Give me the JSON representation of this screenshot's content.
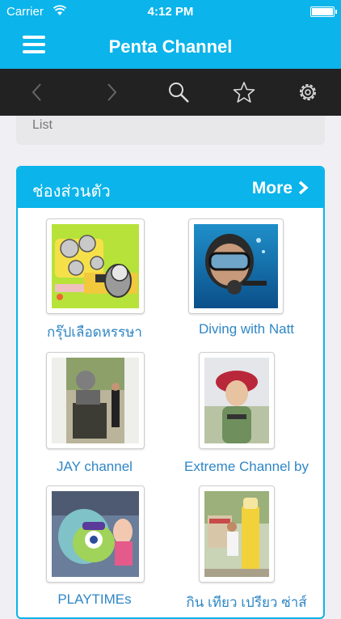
{
  "status_bar": {
    "carrier": "Carrier",
    "time": "4:12 PM"
  },
  "nav": {
    "title": "Penta Channel"
  },
  "toolbar": {
    "icons": [
      "chevron-left-icon",
      "chevron-right-icon",
      "search-icon",
      "star-icon",
      "gear-icon"
    ]
  },
  "list_bar": {
    "label": "List"
  },
  "section": {
    "title": "ช่องส่วนตัว",
    "more_label": "More",
    "channels": [
      {
        "name": "กรุ๊ปเลือดหรรษา"
      },
      {
        "name": "Diving with Natt"
      },
      {
        "name": "JAY channel"
      },
      {
        "name": "Extreme Channel by"
      },
      {
        "name": "PLAYTIMEs"
      },
      {
        "name": "กิน เทียว เปรียว ซ่าส์"
      }
    ]
  },
  "colors": {
    "accent": "#0bb4ea",
    "toolbar": "#222222",
    "link": "#2f86c5"
  }
}
